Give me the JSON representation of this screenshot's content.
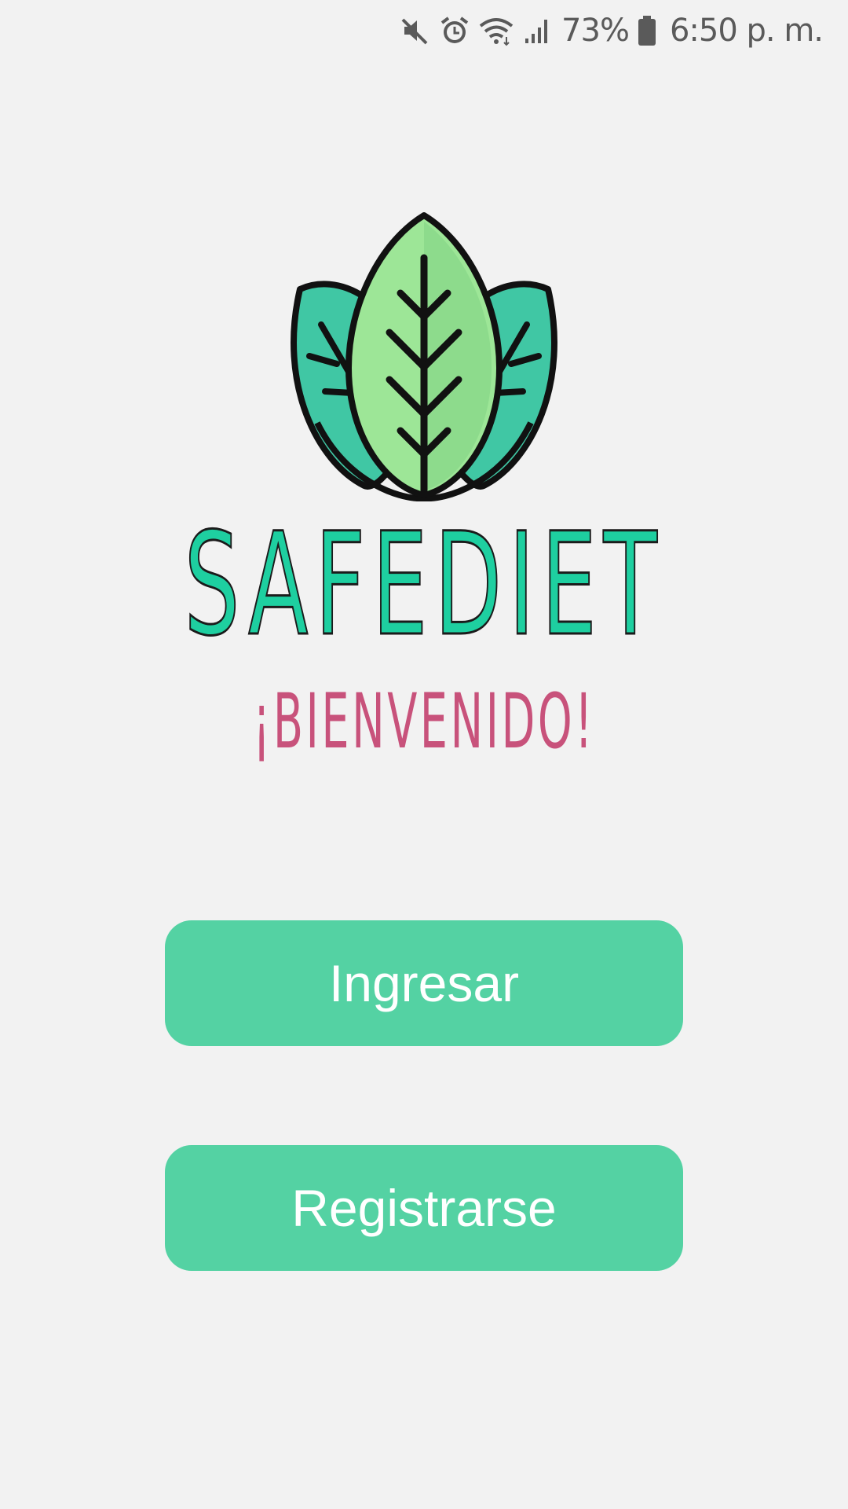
{
  "status_bar": {
    "battery_percent": "73%",
    "time": "6:50 p. m.",
    "icons": [
      "mute-icon",
      "alarm-icon",
      "wifi-icon",
      "signal-icon",
      "battery-icon"
    ]
  },
  "app": {
    "name": "SAFEDIET",
    "welcome": "¡BIENVENIDO!",
    "logo_icon": "leaves-logo-icon"
  },
  "buttons": {
    "login_label": "Ingresar",
    "register_label": "Registrarse"
  },
  "colors": {
    "background": "#f2f2f2",
    "brand_green": "#1ecfa0",
    "welcome_pink": "#c8527b",
    "button_green": "#54d2a3",
    "button_text": "#ffffff"
  }
}
